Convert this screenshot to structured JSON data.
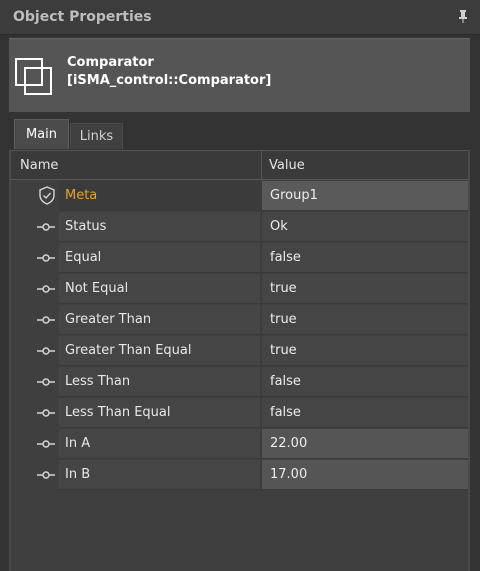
{
  "panel": {
    "title": "Object Properties",
    "pin_icon": "pin-icon"
  },
  "object": {
    "name": "Comparator",
    "type": "[iSMA_control::Comparator]",
    "icon": "component-icon"
  },
  "tabs": [
    {
      "label": "Main",
      "active": true
    },
    {
      "label": "Links",
      "active": false
    }
  ],
  "grid": {
    "columns": {
      "name": "Name",
      "value": "Value"
    },
    "rows": [
      {
        "name": "Meta",
        "value": "Group1",
        "icon": "shield-check-icon",
        "kind": "meta"
      },
      {
        "name": "Status",
        "value": "Ok",
        "icon": "slot-icon",
        "kind": "output"
      },
      {
        "name": "Equal",
        "value": "false",
        "icon": "slot-icon",
        "kind": "output"
      },
      {
        "name": "Not Equal",
        "value": "true",
        "icon": "slot-icon",
        "kind": "output"
      },
      {
        "name": "Greater Than",
        "value": "true",
        "icon": "slot-icon",
        "kind": "output"
      },
      {
        "name": "Greater Than Equal",
        "value": "true",
        "icon": "slot-icon",
        "kind": "output"
      },
      {
        "name": "Less Than",
        "value": "false",
        "icon": "slot-icon",
        "kind": "output"
      },
      {
        "name": "Less Than Equal",
        "value": "false",
        "icon": "slot-icon",
        "kind": "output"
      },
      {
        "name": "In A",
        "value": "22.00",
        "icon": "slot-icon",
        "kind": "input"
      },
      {
        "name": "In B",
        "value": "17.00",
        "icon": "slot-icon",
        "kind": "input"
      }
    ]
  },
  "colors": {
    "meta_label": "#e8a030",
    "background": "#333333",
    "header": "#555555"
  }
}
